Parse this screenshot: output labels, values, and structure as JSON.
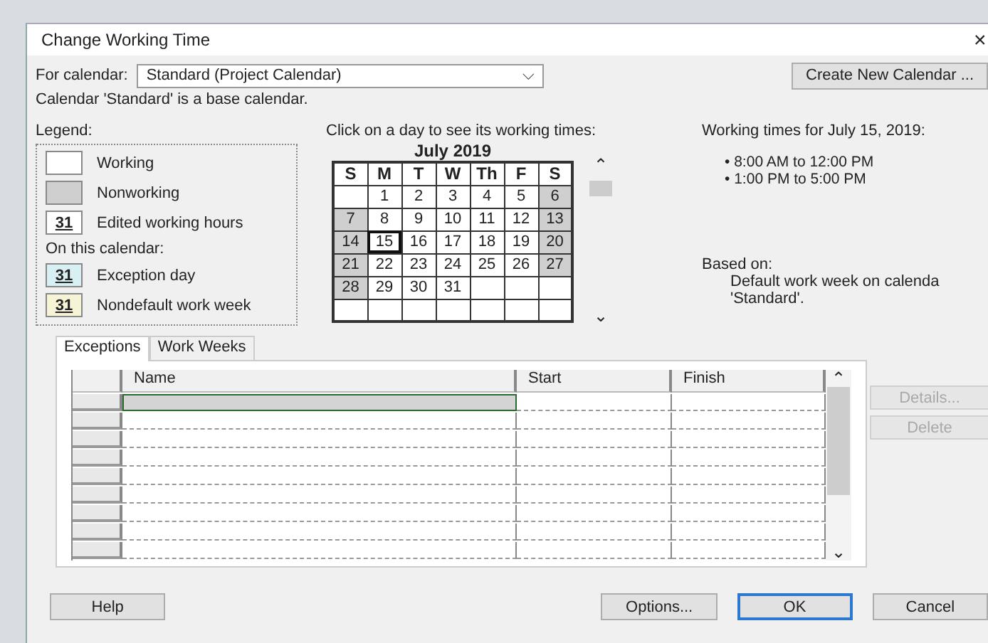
{
  "window": {
    "title": "Change Working Time",
    "close_glyph": "×"
  },
  "calendar_picker": {
    "label": "For calendar:",
    "value": "Standard (Project Calendar)",
    "caret": "⌵"
  },
  "create_button": {
    "label": "Create New Calendar ..."
  },
  "base_note": "Calendar 'Standard' is a base calendar.",
  "legend": {
    "title": "Legend:",
    "general": [
      {
        "kind": "working",
        "label": "Working"
      },
      {
        "kind": "nonworking",
        "label": "Nonworking"
      },
      {
        "kind": "edited",
        "sample": "31",
        "label": "Edited working hours"
      }
    ],
    "calendar_heading": "On this calendar:",
    "calendar_items": [
      {
        "kind": "exception",
        "sample": "31",
        "label": "Exception day"
      },
      {
        "kind": "nondefault",
        "sample": "31",
        "label": "Nondefault work week"
      }
    ]
  },
  "month": {
    "prompt": "Click on a day to see its working times:",
    "title": "July 2019",
    "up": "⌃",
    "down": "⌄",
    "weekdays": [
      "S",
      "M",
      "T",
      "W",
      "Th",
      "F",
      "S"
    ],
    "weeks": [
      [
        {
          "kind": "empty",
          "nonworking": false,
          "selected": false
        },
        {
          "kind": "day",
          "day": "1",
          "nonworking": false,
          "selected": false
        },
        {
          "kind": "day",
          "day": "2",
          "nonworking": false,
          "selected": false
        },
        {
          "kind": "day",
          "day": "3",
          "nonworking": false,
          "selected": false
        },
        {
          "kind": "day",
          "day": "4",
          "nonworking": false,
          "selected": false
        },
        {
          "kind": "day",
          "day": "5",
          "nonworking": false,
          "selected": false
        },
        {
          "kind": "day",
          "day": "6",
          "nonworking": true,
          "selected": false
        }
      ],
      [
        {
          "kind": "day",
          "day": "7",
          "nonworking": true,
          "selected": false
        },
        {
          "kind": "day",
          "day": "8",
          "nonworking": false,
          "selected": false
        },
        {
          "kind": "day",
          "day": "9",
          "nonworking": false,
          "selected": false
        },
        {
          "kind": "day",
          "day": "10",
          "nonworking": false,
          "selected": false
        },
        {
          "kind": "day",
          "day": "11",
          "nonworking": false,
          "selected": false
        },
        {
          "kind": "day",
          "day": "12",
          "nonworking": false,
          "selected": false
        },
        {
          "kind": "day",
          "day": "13",
          "nonworking": true,
          "selected": false
        }
      ],
      [
        {
          "kind": "day",
          "day": "14",
          "nonworking": true,
          "selected": false
        },
        {
          "kind": "day",
          "day": "15",
          "nonworking": false,
          "selected": true
        },
        {
          "kind": "day",
          "day": "16",
          "nonworking": false,
          "selected": false
        },
        {
          "kind": "day",
          "day": "17",
          "nonworking": false,
          "selected": false
        },
        {
          "kind": "day",
          "day": "18",
          "nonworking": false,
          "selected": false
        },
        {
          "kind": "day",
          "day": "19",
          "nonworking": false,
          "selected": false
        },
        {
          "kind": "day",
          "day": "20",
          "nonworking": true,
          "selected": false
        }
      ],
      [
        {
          "kind": "day",
          "day": "21",
          "nonworking": true,
          "selected": false
        },
        {
          "kind": "day",
          "day": "22",
          "nonworking": false,
          "selected": false
        },
        {
          "kind": "day",
          "day": "23",
          "nonworking": false,
          "selected": false
        },
        {
          "kind": "day",
          "day": "24",
          "nonworking": false,
          "selected": false
        },
        {
          "kind": "day",
          "day": "25",
          "nonworking": false,
          "selected": false
        },
        {
          "kind": "day",
          "day": "26",
          "nonworking": false,
          "selected": false
        },
        {
          "kind": "day",
          "day": "27",
          "nonworking": true,
          "selected": false
        }
      ],
      [
        {
          "kind": "day",
          "day": "28",
          "nonworking": true,
          "selected": false
        },
        {
          "kind": "day",
          "day": "29",
          "nonworking": false,
          "selected": false
        },
        {
          "kind": "day",
          "day": "30",
          "nonworking": false,
          "selected": false
        },
        {
          "kind": "day",
          "day": "31",
          "nonworking": false,
          "selected": false
        },
        {
          "kind": "empty",
          "nonworking": false,
          "selected": false
        },
        {
          "kind": "empty",
          "nonworking": false,
          "selected": false
        },
        {
          "kind": "empty",
          "nonworking": false,
          "selected": false
        }
      ],
      [
        {
          "kind": "empty",
          "nonworking": false,
          "selected": false
        },
        {
          "kind": "empty",
          "nonworking": false,
          "selected": false
        },
        {
          "kind": "empty",
          "nonworking": false,
          "selected": false
        },
        {
          "kind": "empty",
          "nonworking": false,
          "selected": false
        },
        {
          "kind": "empty",
          "nonworking": false,
          "selected": false
        },
        {
          "kind": "empty",
          "nonworking": false,
          "selected": false
        },
        {
          "kind": "empty",
          "nonworking": false,
          "selected": false
        }
      ]
    ]
  },
  "working_times": {
    "title": "Working times for July 15, 2019:",
    "times": [
      "• 8:00 AM to 12:00 PM",
      "• 1:00 PM to 5:00 PM"
    ],
    "based_on_label": "Based on:",
    "based_on_lines": [
      "Default work week on calenda",
      "'Standard'."
    ]
  },
  "tabs": [
    {
      "label": "Exceptions",
      "selected": true
    },
    {
      "label": "Work Weeks",
      "selected": false
    }
  ],
  "table": {
    "columns": [
      "Name",
      "Start",
      "Finish"
    ],
    "scroll_up": "⌃",
    "scroll_down": "⌄",
    "rows": [
      {
        "selected": true
      },
      {
        "selected": false
      },
      {
        "selected": false
      },
      {
        "selected": false
      },
      {
        "selected": false
      },
      {
        "selected": false
      },
      {
        "selected": false
      },
      {
        "selected": false
      },
      {
        "selected": false
      }
    ]
  },
  "side_buttons": [
    {
      "label": "Details...",
      "disabled": true
    },
    {
      "label": "Delete",
      "disabled": true
    }
  ],
  "footer_buttons": [
    {
      "label": "Help",
      "default": false
    },
    {
      "label": "Options...",
      "default": false
    },
    {
      "label": "OK",
      "default": true
    },
    {
      "label": "Cancel",
      "default": false
    }
  ]
}
